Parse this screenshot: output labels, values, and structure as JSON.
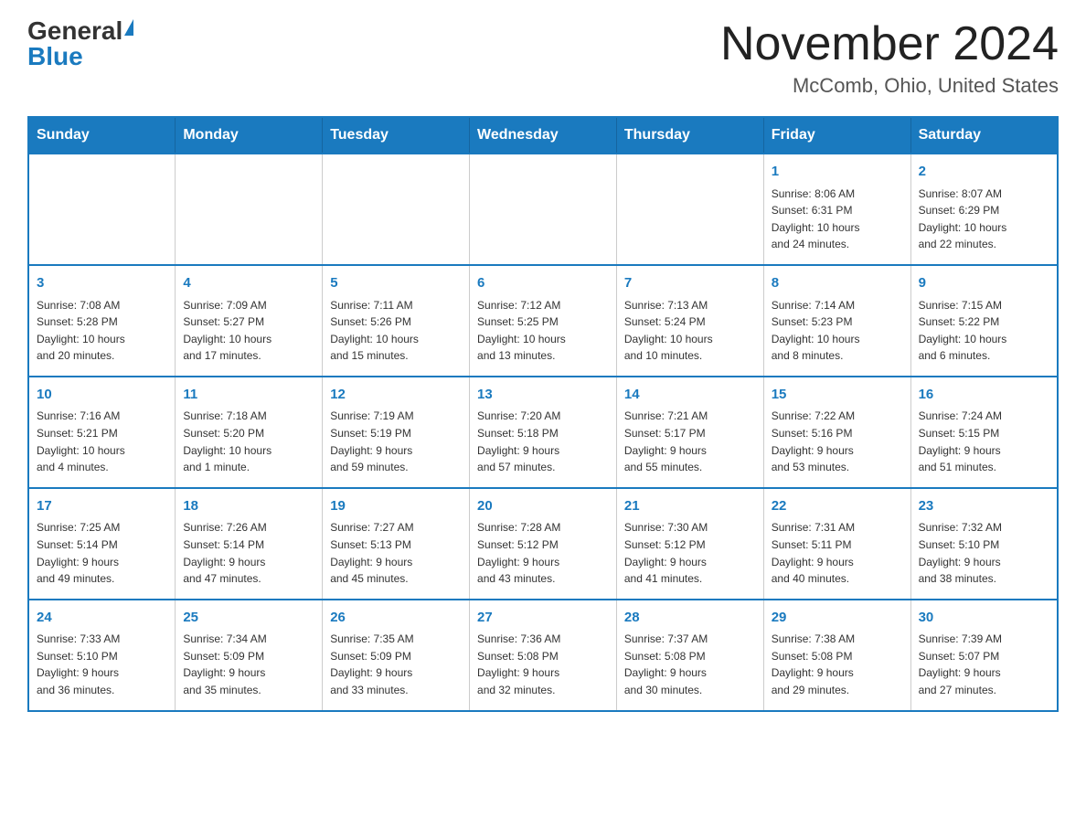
{
  "header": {
    "logo_general": "General",
    "logo_blue": "Blue",
    "month_title": "November 2024",
    "location": "McComb, Ohio, United States"
  },
  "weekdays": [
    "Sunday",
    "Monday",
    "Tuesday",
    "Wednesday",
    "Thursday",
    "Friday",
    "Saturday"
  ],
  "weeks": [
    [
      {
        "day": "",
        "info": ""
      },
      {
        "day": "",
        "info": ""
      },
      {
        "day": "",
        "info": ""
      },
      {
        "day": "",
        "info": ""
      },
      {
        "day": "",
        "info": ""
      },
      {
        "day": "1",
        "info": "Sunrise: 8:06 AM\nSunset: 6:31 PM\nDaylight: 10 hours\nand 24 minutes."
      },
      {
        "day": "2",
        "info": "Sunrise: 8:07 AM\nSunset: 6:29 PM\nDaylight: 10 hours\nand 22 minutes."
      }
    ],
    [
      {
        "day": "3",
        "info": "Sunrise: 7:08 AM\nSunset: 5:28 PM\nDaylight: 10 hours\nand 20 minutes."
      },
      {
        "day": "4",
        "info": "Sunrise: 7:09 AM\nSunset: 5:27 PM\nDaylight: 10 hours\nand 17 minutes."
      },
      {
        "day": "5",
        "info": "Sunrise: 7:11 AM\nSunset: 5:26 PM\nDaylight: 10 hours\nand 15 minutes."
      },
      {
        "day": "6",
        "info": "Sunrise: 7:12 AM\nSunset: 5:25 PM\nDaylight: 10 hours\nand 13 minutes."
      },
      {
        "day": "7",
        "info": "Sunrise: 7:13 AM\nSunset: 5:24 PM\nDaylight: 10 hours\nand 10 minutes."
      },
      {
        "day": "8",
        "info": "Sunrise: 7:14 AM\nSunset: 5:23 PM\nDaylight: 10 hours\nand 8 minutes."
      },
      {
        "day": "9",
        "info": "Sunrise: 7:15 AM\nSunset: 5:22 PM\nDaylight: 10 hours\nand 6 minutes."
      }
    ],
    [
      {
        "day": "10",
        "info": "Sunrise: 7:16 AM\nSunset: 5:21 PM\nDaylight: 10 hours\nand 4 minutes."
      },
      {
        "day": "11",
        "info": "Sunrise: 7:18 AM\nSunset: 5:20 PM\nDaylight: 10 hours\nand 1 minute."
      },
      {
        "day": "12",
        "info": "Sunrise: 7:19 AM\nSunset: 5:19 PM\nDaylight: 9 hours\nand 59 minutes."
      },
      {
        "day": "13",
        "info": "Sunrise: 7:20 AM\nSunset: 5:18 PM\nDaylight: 9 hours\nand 57 minutes."
      },
      {
        "day": "14",
        "info": "Sunrise: 7:21 AM\nSunset: 5:17 PM\nDaylight: 9 hours\nand 55 minutes."
      },
      {
        "day": "15",
        "info": "Sunrise: 7:22 AM\nSunset: 5:16 PM\nDaylight: 9 hours\nand 53 minutes."
      },
      {
        "day": "16",
        "info": "Sunrise: 7:24 AM\nSunset: 5:15 PM\nDaylight: 9 hours\nand 51 minutes."
      }
    ],
    [
      {
        "day": "17",
        "info": "Sunrise: 7:25 AM\nSunset: 5:14 PM\nDaylight: 9 hours\nand 49 minutes."
      },
      {
        "day": "18",
        "info": "Sunrise: 7:26 AM\nSunset: 5:14 PM\nDaylight: 9 hours\nand 47 minutes."
      },
      {
        "day": "19",
        "info": "Sunrise: 7:27 AM\nSunset: 5:13 PM\nDaylight: 9 hours\nand 45 minutes."
      },
      {
        "day": "20",
        "info": "Sunrise: 7:28 AM\nSunset: 5:12 PM\nDaylight: 9 hours\nand 43 minutes."
      },
      {
        "day": "21",
        "info": "Sunrise: 7:30 AM\nSunset: 5:12 PM\nDaylight: 9 hours\nand 41 minutes."
      },
      {
        "day": "22",
        "info": "Sunrise: 7:31 AM\nSunset: 5:11 PM\nDaylight: 9 hours\nand 40 minutes."
      },
      {
        "day": "23",
        "info": "Sunrise: 7:32 AM\nSunset: 5:10 PM\nDaylight: 9 hours\nand 38 minutes."
      }
    ],
    [
      {
        "day": "24",
        "info": "Sunrise: 7:33 AM\nSunset: 5:10 PM\nDaylight: 9 hours\nand 36 minutes."
      },
      {
        "day": "25",
        "info": "Sunrise: 7:34 AM\nSunset: 5:09 PM\nDaylight: 9 hours\nand 35 minutes."
      },
      {
        "day": "26",
        "info": "Sunrise: 7:35 AM\nSunset: 5:09 PM\nDaylight: 9 hours\nand 33 minutes."
      },
      {
        "day": "27",
        "info": "Sunrise: 7:36 AM\nSunset: 5:08 PM\nDaylight: 9 hours\nand 32 minutes."
      },
      {
        "day": "28",
        "info": "Sunrise: 7:37 AM\nSunset: 5:08 PM\nDaylight: 9 hours\nand 30 minutes."
      },
      {
        "day": "29",
        "info": "Sunrise: 7:38 AM\nSunset: 5:08 PM\nDaylight: 9 hours\nand 29 minutes."
      },
      {
        "day": "30",
        "info": "Sunrise: 7:39 AM\nSunset: 5:07 PM\nDaylight: 9 hours\nand 27 minutes."
      }
    ]
  ]
}
